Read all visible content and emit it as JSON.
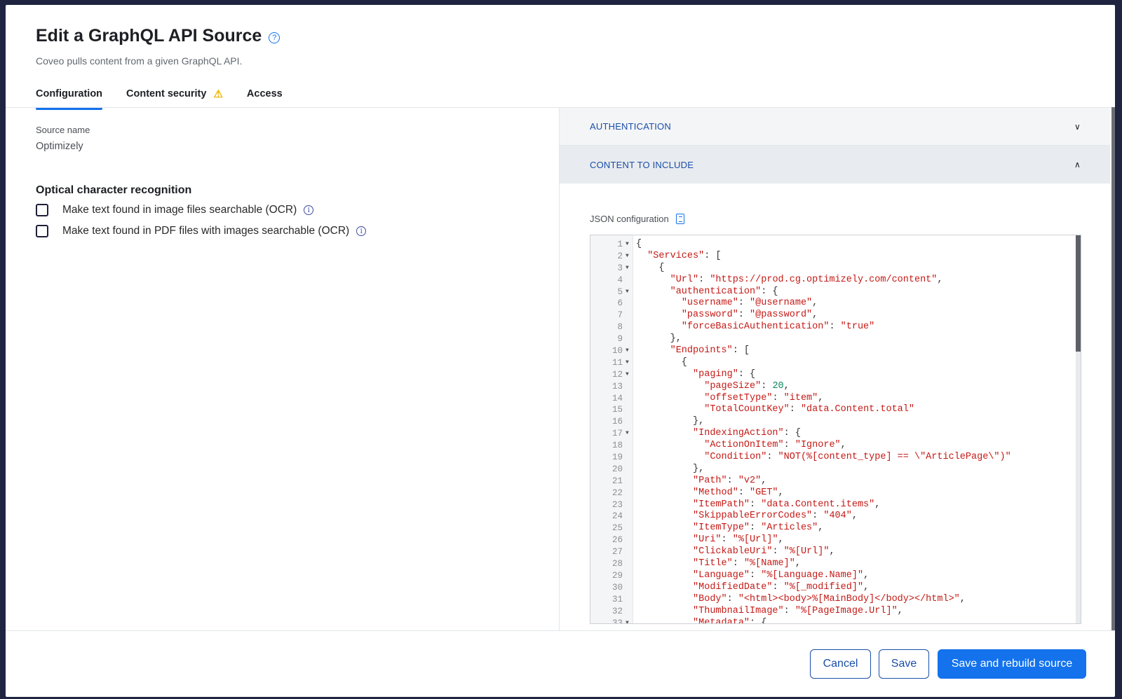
{
  "header": {
    "title": "Edit a GraphQL API Source",
    "subtitle": "Coveo pulls content from a given GraphQL API.",
    "help_icon": "?"
  },
  "tabs": [
    {
      "label": "Configuration",
      "active": true
    },
    {
      "label": "Content security",
      "warning_icon": "⚠"
    },
    {
      "label": "Access"
    }
  ],
  "left": {
    "source_name_label": "Source name",
    "source_name_value": "Optimizely",
    "ocr_heading": "Optical character recognition",
    "checkboxes": [
      {
        "label": "Make text found in image files searchable (OCR)",
        "checked": false
      },
      {
        "label": "Make text found in PDF files with images searchable (OCR)",
        "checked": false
      }
    ]
  },
  "right": {
    "sections": [
      {
        "label": "AUTHENTICATION",
        "expanded": false,
        "icon": "⌄"
      },
      {
        "label": "CONTENT TO INCLUDE",
        "expanded": true,
        "icon": "⌃"
      }
    ],
    "json_label": "JSON configuration",
    "foldable_lines": [
      1,
      2,
      3,
      5,
      10,
      11,
      12,
      17,
      33
    ],
    "code_lines": [
      "{",
      "  \"Services\": [",
      "    {",
      "      \"Url\": \"https://prod.cg.optimizely.com/content\",",
      "      \"authentication\": {",
      "        \"username\": \"@username\",",
      "        \"password\": \"@password\",",
      "        \"forceBasicAuthentication\": \"true\"",
      "      },",
      "      \"Endpoints\": [",
      "        {",
      "          \"paging\": {",
      "            \"pageSize\": 20,",
      "            \"offsetType\": \"item\",",
      "            \"TotalCountKey\": \"data.Content.total\"",
      "          },",
      "          \"IndexingAction\": {",
      "            \"ActionOnItem\": \"Ignore\",",
      "            \"Condition\": \"NOT(%[content_type] == \\\"ArticlePage\\\")\"",
      "          },",
      "          \"Path\": \"v2\",",
      "          \"Method\": \"GET\",",
      "          \"ItemPath\": \"data.Content.items\",",
      "          \"SkippableErrorCodes\": \"404\",",
      "          \"ItemType\": \"Articles\",",
      "          \"Uri\": \"%[Url]\",",
      "          \"ClickableUri\": \"%[Url]\",",
      "          \"Title\": \"%[Name]\",",
      "          \"Language\": \"%[Language.Name]\",",
      "          \"ModifiedDate\": \"%[_modified]\",",
      "          \"Body\": \"<html><body>%[MainBody]</body></html>\",",
      "          \"ThumbnailImage\": \"%[PageImage.Url]\",",
      "          \"Metadata\": {"
    ]
  },
  "footer": {
    "cancel": "Cancel",
    "save": "Save",
    "save_rebuild": "Save and rebuild source"
  },
  "colors": {
    "primary": "#1372ec",
    "string": "#c41a16",
    "number": "#098658"
  }
}
